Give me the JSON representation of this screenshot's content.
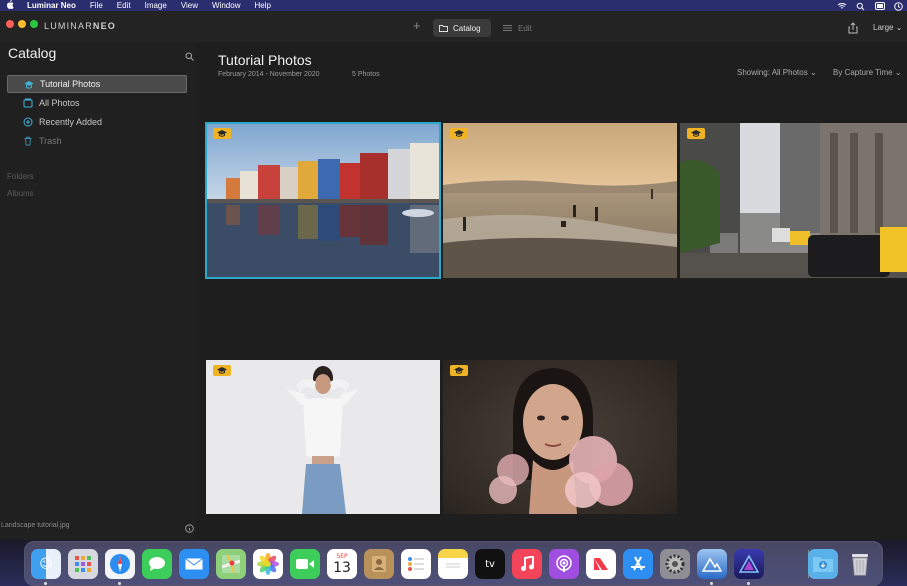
{
  "menubar": {
    "app_name": "Luminar Neo",
    "items": [
      "File",
      "Edit",
      "Image",
      "View",
      "Window",
      "Help"
    ]
  },
  "titlebar": {
    "logo_light": "LUMINAR",
    "logo_bold": "NEO",
    "add_icon": "+",
    "catalog_label": "Catalog",
    "edit_label": "Edit",
    "size_label": "Large"
  },
  "sidebar": {
    "title": "Catalog",
    "items": [
      {
        "label": "Tutorial Photos",
        "icon": "graduation-cap-icon"
      },
      {
        "label": "All Photos",
        "icon": "photos-icon"
      },
      {
        "label": "Recently Added",
        "icon": "plus-circle-icon"
      },
      {
        "label": "Trash",
        "icon": "trash-icon"
      }
    ],
    "sections": [
      "Folders",
      "Albums"
    ],
    "footer_file": "Landscape tutorial.jpg"
  },
  "main": {
    "title": "Tutorial Photos",
    "date_range": "February 2014 - November 2020",
    "photo_count": "5 Photos",
    "showing": "Showing: All Photos",
    "sort": "By Capture Time"
  },
  "photos": [
    {
      "subject": "colorful harbor houses",
      "selected": true
    },
    {
      "subject": "beach at sunset",
      "selected": false
    },
    {
      "subject": "city street with taxis",
      "selected": false
    },
    {
      "subject": "woman in white blouse",
      "selected": false
    },
    {
      "subject": "woman portrait with pink flower",
      "selected": false
    }
  ],
  "dock": {
    "calendar_month": "SEP",
    "calendar_day": "13",
    "tv_label": "tv",
    "items": [
      "finder",
      "launchpad",
      "safari",
      "messages",
      "mail",
      "maps",
      "photos",
      "facetime",
      "calendar",
      "contacts",
      "reminders",
      "notes",
      "apple-tv",
      "music",
      "podcasts",
      "news",
      "app-store",
      "system-preferences",
      "luminar",
      "luminar-neo",
      "downloads",
      "trash"
    ]
  },
  "colors": {
    "accent": "#2aa9c9",
    "badge": "#f0b323",
    "menubar": "#2a2d6e"
  }
}
